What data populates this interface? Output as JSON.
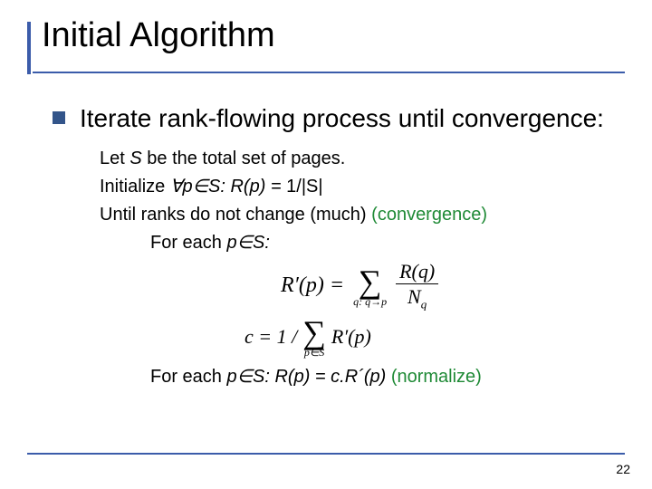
{
  "title": "Initial Algorithm",
  "bullet": "Iterate rank-flowing process until convergence:",
  "algo": {
    "line1_pre": "Let ",
    "line1_S": "S",
    "line1_post": " be the total set of pages.",
    "line2_pre": "Initialize ",
    "line2_quant": "∀p∈S: R(p) = ",
    "line2_val": "1/|S|",
    "line3_pre": "Until ranks do not change (much)  ",
    "line3_note": "(convergence)",
    "line4": "For each p∈S:",
    "line5_pre": "For each ",
    "line5_mid": "p∈S: R(p) = c.R´(p)",
    "line5_note": "   (normalize)"
  },
  "formula": {
    "lhs": "R′(p) =",
    "sum_sub": "q: q→p",
    "frac_num": "R(q)",
    "frac_den_N": "N",
    "frac_den_sub": "q",
    "c_lhs": "c = 1 /",
    "sum2_sub": "p∈S",
    "sum2_term": "R′(p)"
  },
  "page_number": "22"
}
